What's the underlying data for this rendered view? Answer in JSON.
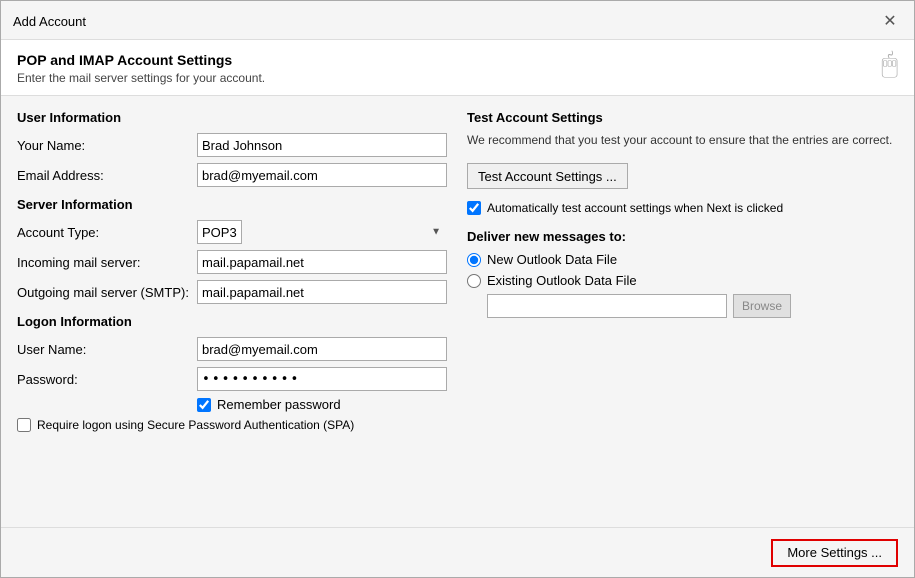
{
  "dialog": {
    "title": "Add Account",
    "close_label": "✕"
  },
  "header": {
    "title": "POP and IMAP Account Settings",
    "subtitle": "Enter the mail server settings for your account.",
    "icon": "🖐"
  },
  "left_panel": {
    "user_info_title": "User Information",
    "your_name_label": "Your Name:",
    "your_name_value": "Brad Johnson",
    "email_label": "Email Address:",
    "email_value": "brad@myemail.com",
    "server_info_title": "Server Information",
    "account_type_label": "Account Type:",
    "account_type_value": "POP3",
    "incoming_label": "Incoming mail server:",
    "incoming_value": "mail.papamail.net",
    "outgoing_label": "Outgoing mail server (SMTP):",
    "outgoing_value": "mail.papamail.net",
    "logon_info_title": "Logon Information",
    "username_label": "User Name:",
    "username_value": "brad@myemail.com",
    "password_label": "Password:",
    "password_value": "**********",
    "remember_label": "Remember password",
    "spa_label": "Require logon using Secure Password Authentication (SPA)"
  },
  "right_panel": {
    "test_settings_title": "Test Account Settings",
    "test_desc": "We recommend that you test your account to ensure that the entries are correct.",
    "test_btn_label": "Test Account Settings ...",
    "auto_test_label": "Automatically test account settings when Next is clicked",
    "deliver_title": "Deliver new messages to:",
    "new_outlook_label": "New Outlook Data File",
    "existing_label": "Existing Outlook Data File",
    "existing_value": "",
    "browse_label": "Browse",
    "more_settings_label": "More Settings ..."
  }
}
